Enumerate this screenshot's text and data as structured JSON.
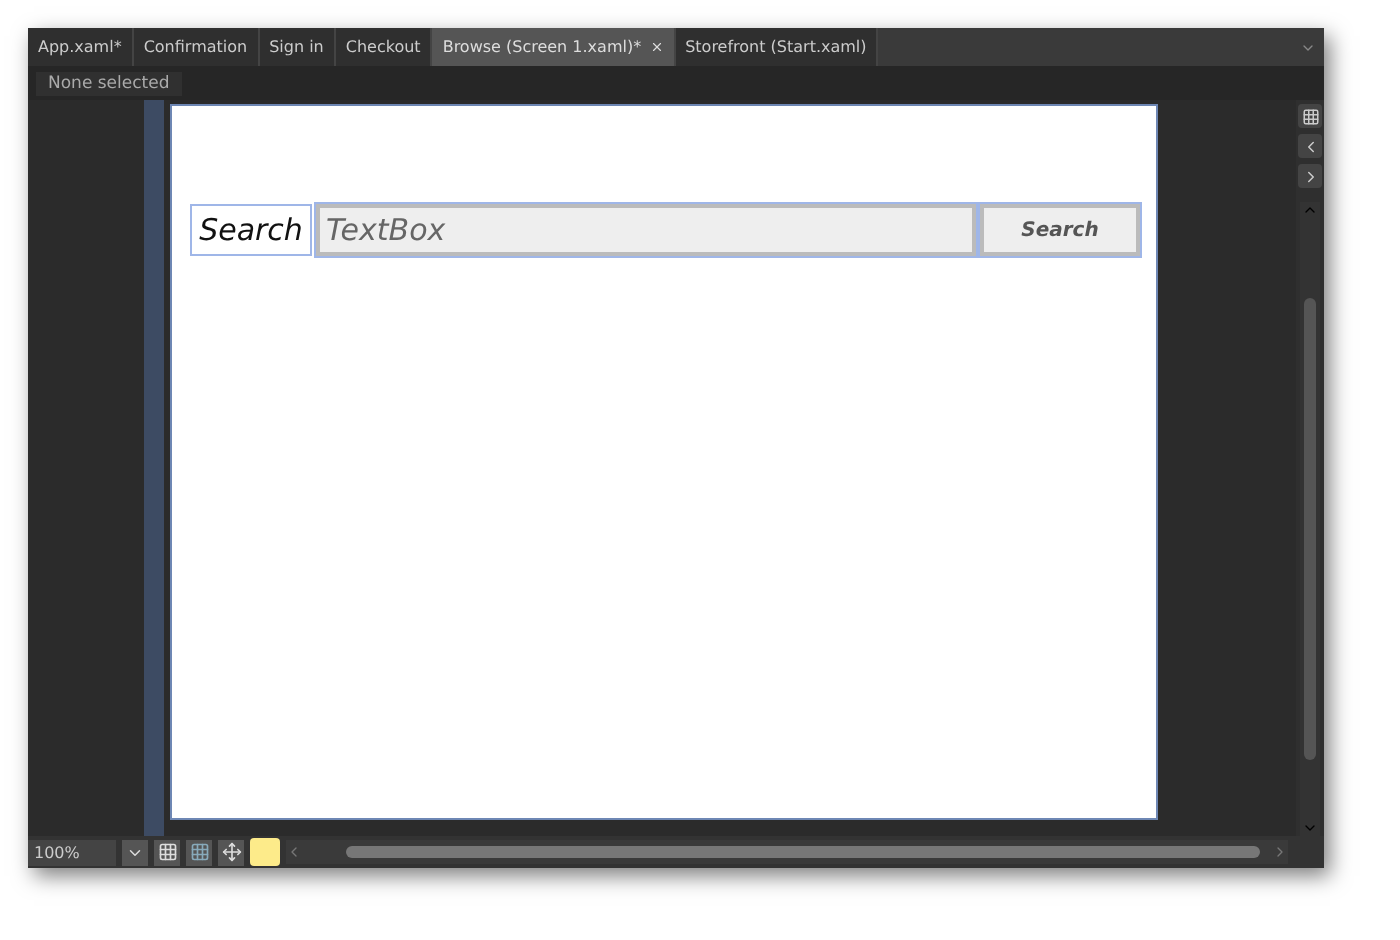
{
  "tabs": [
    {
      "label": "App.xaml*",
      "selected": false
    },
    {
      "label": "Confirmation",
      "selected": false
    },
    {
      "label": "Sign in",
      "selected": false
    },
    {
      "label": "Checkout",
      "selected": false
    },
    {
      "label": "Browse (Screen 1.xaml)*",
      "selected": true
    },
    {
      "label": "Storefront (Start.xaml)",
      "selected": false
    }
  ],
  "breadcrumb": "None selected",
  "sketch": {
    "label": "Search",
    "textbox_placeholder": "TextBox",
    "button": "Search"
  },
  "zoom": {
    "value": "100%"
  }
}
